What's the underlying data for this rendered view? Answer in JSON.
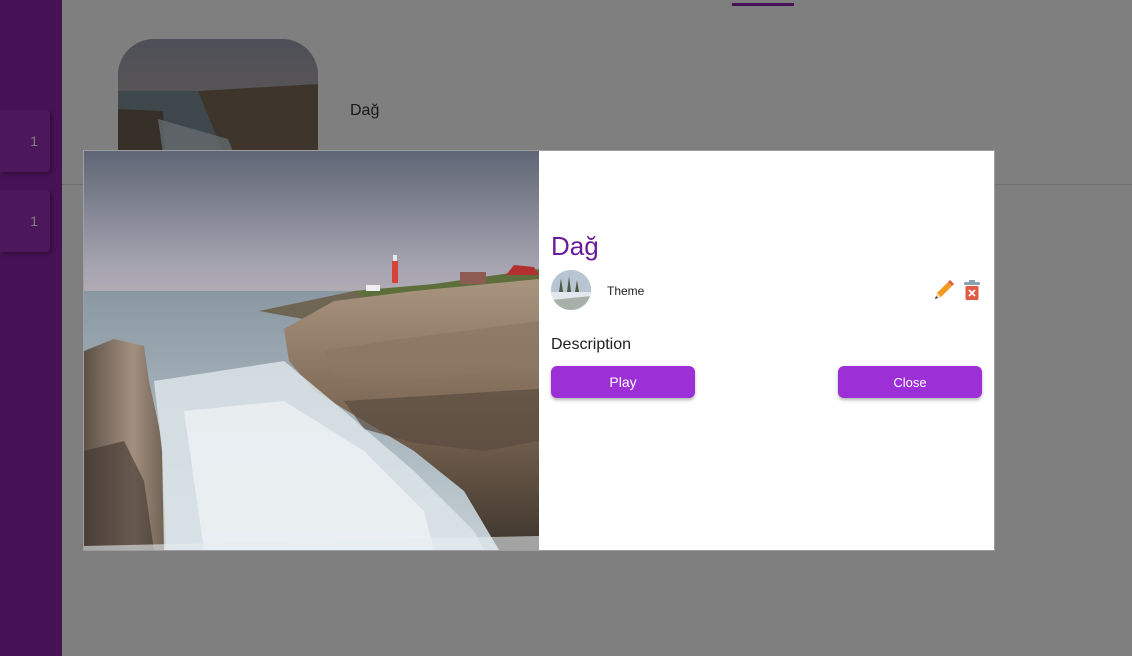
{
  "sidebar": {
    "badges": [
      {
        "count": "1"
      },
      {
        "count": "1"
      }
    ]
  },
  "list": {
    "items": [
      {
        "title": "Dağ"
      }
    ]
  },
  "dialog": {
    "title": "Dağ",
    "theme_label": "Theme",
    "description_label": "Description",
    "play_label": "Play",
    "close_label": "Close",
    "icons": {
      "edit": "pencil-icon",
      "delete": "trash-icon"
    }
  },
  "colors": {
    "sidebar": "#8e24aa",
    "title": "#6a1b9a",
    "button": "#9c2fd6",
    "edit_icon": "#f29a1f",
    "delete_icon": "#e05a44"
  }
}
